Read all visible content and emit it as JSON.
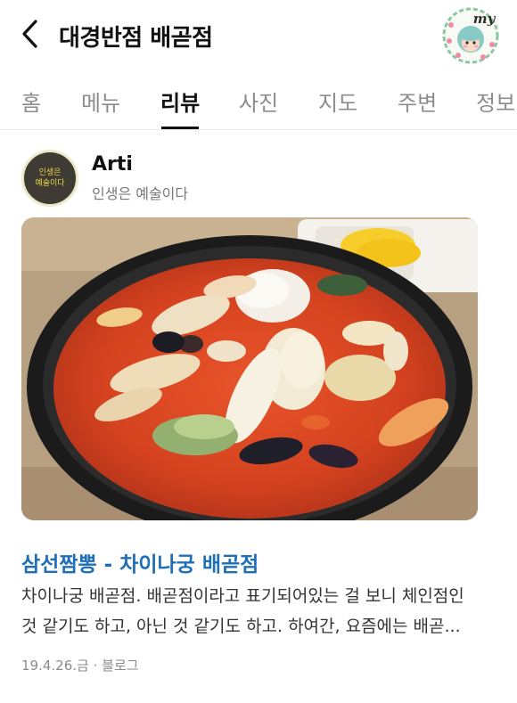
{
  "header": {
    "title": "대경반점 배곧점",
    "my_badge": "my"
  },
  "tabs": [
    {
      "label": "홈",
      "active": false
    },
    {
      "label": "메뉴",
      "active": false
    },
    {
      "label": "리뷰",
      "active": true
    },
    {
      "label": "사진",
      "active": false
    },
    {
      "label": "지도",
      "active": false
    },
    {
      "label": "주변",
      "active": false
    },
    {
      "label": "정보",
      "active": false
    }
  ],
  "review": {
    "avatar_text": [
      "인생은",
      "예술이다"
    ],
    "author": "Arti",
    "blog_name": "인생은 예술이다",
    "post_title": "삼선짬뽕 - 차이나궁 배곧점",
    "excerpt_line1": "차이나궁 배곧점. 배곧점이라고 표기되어있는 걸 보니 체인점인",
    "excerpt_line2": "것 같기도 하고, 아닌 것 같기도 하고. 하여간, 요즘에는 배곧...",
    "date": "19.4.26.금",
    "separator": "·",
    "source": "블로그"
  },
  "colors": {
    "link_blue": "#1e6fb8",
    "tab_active": "#111111",
    "tab_inactive": "#8c8c8c"
  }
}
